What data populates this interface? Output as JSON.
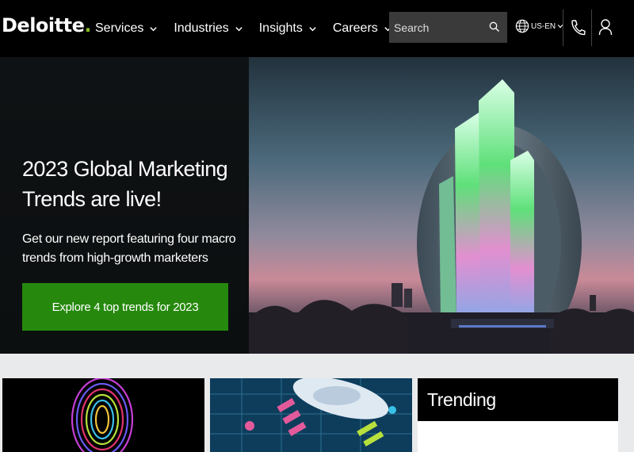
{
  "header": {
    "logo_text": "Deloitte",
    "logo_dot": ".",
    "nav": [
      {
        "label": "Services"
      },
      {
        "label": "Industries"
      },
      {
        "label": "Insights"
      },
      {
        "label": "Careers"
      }
    ],
    "search_placeholder": "Search",
    "locale": "US-EN",
    "icons": [
      "search-icon",
      "globe-icon",
      "phone-icon",
      "user-icon"
    ]
  },
  "hero": {
    "title_line1": "2023 Global Marketing",
    "title_line2": "Trends are live!",
    "subtitle": "Get our new report featuring four macro trends from high-growth marketers",
    "cta_label": "Explore 4 top trends for 2023"
  },
  "cards": {
    "trending_label": "Trending"
  },
  "colors": {
    "brand_green": "#86bc25",
    "cta_green": "#26890d",
    "header_bg": "#000000",
    "search_bg": "#3a3a3a"
  }
}
